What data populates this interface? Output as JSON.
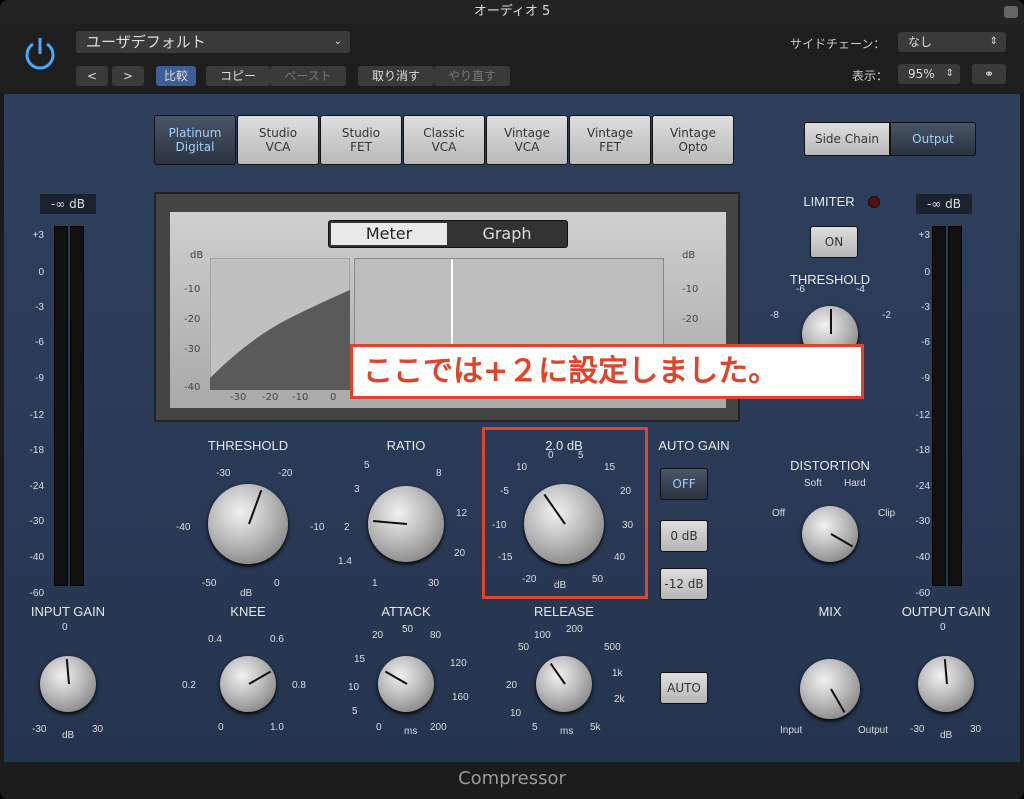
{
  "window": {
    "title": "オーディオ 5"
  },
  "header": {
    "preset": "ユーザデフォルト",
    "prev": "<",
    "next": ">",
    "compare": "比較",
    "copy": "コピー",
    "paste": "ペースト",
    "undo": "取り消す",
    "redo": "やり直す",
    "sidechain_label": "サイドチェーン：",
    "sidechain_value": "なし",
    "view_label": "表示：",
    "view_value": "95%"
  },
  "models": [
    {
      "label": "Platinum\nDigital",
      "selected": true
    },
    {
      "label": "Studio\nVCA",
      "selected": false
    },
    {
      "label": "Studio\nFET",
      "selected": false
    },
    {
      "label": "Classic\nVCA",
      "selected": false
    },
    {
      "label": "Vintage\nVCA",
      "selected": false
    },
    {
      "label": "Vintage\nFET",
      "selected": false
    },
    {
      "label": "Vintage\nOpto",
      "selected": false
    }
  ],
  "routing": {
    "side_chain": "Side Chain",
    "output": "Output"
  },
  "display": {
    "tab_meter": "Meter",
    "tab_graph": "Graph",
    "graph_db": "dB",
    "graph_y": [
      "-10",
      "-20",
      "-30",
      "-40"
    ],
    "graph_x": [
      "-30",
      "-20",
      "-10",
      "0"
    ],
    "right_scale": [
      "dB",
      "-10",
      "-20"
    ]
  },
  "input_meter": {
    "readout": "-∞ dB"
  },
  "output_meter": {
    "readout": "-∞ dB"
  },
  "meter_scale": [
    "+3",
    "0",
    "-3",
    "-6",
    "-9",
    "-12",
    "-18",
    "-24",
    "-30",
    "-40",
    "-60"
  ],
  "knobs": {
    "threshold": {
      "label": "THRESHOLD",
      "ticks": [
        "-30",
        "-20",
        "-40",
        "-10",
        "-50",
        "dB",
        "0"
      ]
    },
    "ratio": {
      "label": "RATIO",
      "ticks": [
        "5",
        "8",
        "3",
        "12",
        "2",
        "20",
        "1.4",
        "1",
        "30"
      ]
    },
    "makeup": {
      "label": "2.0 dB",
      "ticks": [
        "0",
        "5",
        "10",
        "15",
        "-5",
        "20",
        "-10",
        "30",
        "-15",
        "40",
        "-20",
        "dB",
        "50"
      ]
    },
    "knee": {
      "label": "KNEE",
      "ticks": [
        "0.4",
        "0.6",
        "0.2",
        "0.8",
        "0",
        "1.0"
      ]
    },
    "attack": {
      "label": "ATTACK",
      "ticks": [
        "20",
        "50",
        "80",
        "15",
        "120",
        "10",
        "160",
        "5",
        "0",
        "ms",
        "200"
      ]
    },
    "release": {
      "label": "RELEASE",
      "ticks": [
        "100",
        "200",
        "50",
        "500",
        "20",
        "1k",
        "10",
        "2k",
        "5",
        "ms",
        "5k"
      ]
    },
    "input_gain": {
      "label": "INPUT GAIN",
      "ticks": [
        "0",
        "-30",
        "dB",
        "30"
      ]
    },
    "output_gain": {
      "label": "OUTPUT GAIN",
      "ticks": [
        "0",
        "-30",
        "dB",
        "30"
      ]
    },
    "limiter_threshold": {
      "label": "THRESHOLD",
      "ticks": [
        "-6",
        "-4",
        "-8",
        "-2"
      ]
    },
    "distortion": {
      "label": "DISTORTION",
      "ticks": [
        "Soft",
        "Hard",
        "Off",
        "Clip"
      ]
    },
    "mix": {
      "label": "MIX",
      "ticks": [
        "Input",
        "Output"
      ]
    }
  },
  "auto_gain": {
    "label": "AUTO GAIN",
    "off": "OFF",
    "zero": "0 dB",
    "minus12": "-12 dB"
  },
  "auto_release": "AUTO",
  "limiter": {
    "label": "LIMITER",
    "on": "ON"
  },
  "callout": "ここでは+２に設定しました。",
  "footer": "Compressor",
  "colors": {
    "accent": "#9fd2ff",
    "callout": "#e0442a",
    "panel": "#2e3f5c"
  }
}
